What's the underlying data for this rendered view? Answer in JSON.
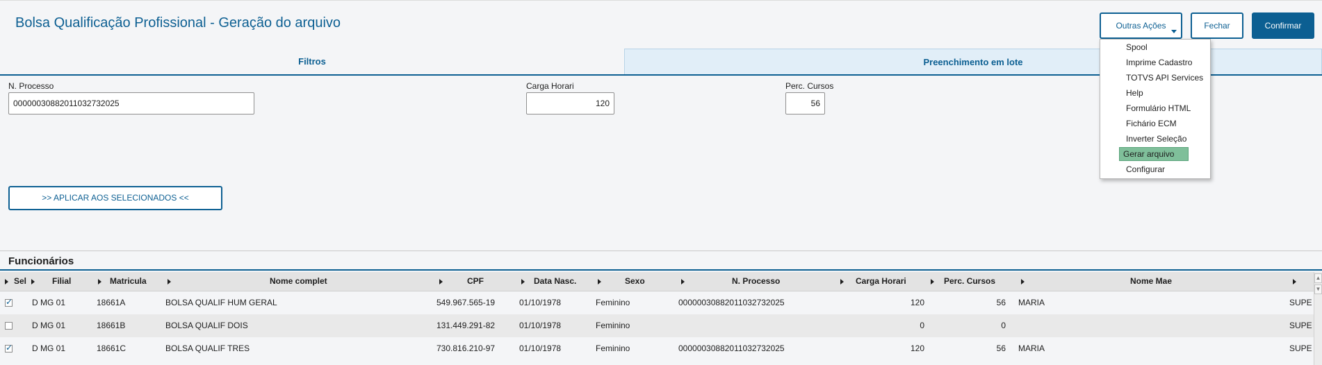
{
  "header": {
    "title": "Bolsa Qualificação Profissional - Geração do arquivo",
    "outras_acoes_label": "Outras Ações",
    "fechar_label": "Fechar",
    "confirmar_label": "Confirmar"
  },
  "tabs": [
    {
      "label": "Filtros",
      "active": false
    },
    {
      "label": "Preenchimento em lote",
      "active": true
    }
  ],
  "form": {
    "processo_label": "N. Processo",
    "processo_value": "0000003088201103273202 5",
    "carga_label": "Carga Horari",
    "carga_value": "120",
    "perc_label": "Perc. Cursos",
    "perc_value": "56",
    "apply_label": ">> APLICAR AOS SELECIONADOS <<"
  },
  "section": {
    "title": "Funcionários"
  },
  "table": {
    "headers": [
      "Sel",
      "Filial",
      "Matricula",
      "Nome complet",
      "CPF",
      "Data Nasc.",
      "Sexo",
      "N. Processo",
      "Carga Horari",
      "Perc. Cursos",
      "Nome Mae"
    ],
    "rows": [
      {
        "selected": true,
        "filial": "D MG 01",
        "matricula": "18661A",
        "nome": "BOLSA QUALIF HUM GERAL",
        "cpf": "549.967.565-19",
        "data_nasc": "01/10/1978",
        "sexo": "Feminino",
        "processo": "00000030882011032732025",
        "carga": "120",
        "perc": "56",
        "nome_mae": "MARIA",
        "extra": "SUPE"
      },
      {
        "selected": false,
        "filial": "D MG 01",
        "matricula": "18661B",
        "nome": "BOLSA QUALIF DOIS",
        "cpf": "131.449.291-82",
        "data_nasc": "01/10/1978",
        "sexo": "Feminino",
        "processo": "",
        "carga": "0",
        "perc": "0",
        "nome_mae": "",
        "extra": "SUPE"
      },
      {
        "selected": true,
        "filial": "D MG 01",
        "matricula": "18661C",
        "nome": "BOLSA QUALIF TRES",
        "cpf": "730.816.210-97",
        "data_nasc": "01/10/1978",
        "sexo": "Feminino",
        "processo": "00000030882011032732025",
        "carga": "120",
        "perc": "56",
        "nome_mae": "MARIA",
        "extra": "SUPE"
      }
    ]
  },
  "menu": {
    "items": [
      {
        "label": "Spool",
        "active": false
      },
      {
        "label": "Imprime Cadastro",
        "active": false
      },
      {
        "label": "TOTVS API Services",
        "active": false
      },
      {
        "label": "Help",
        "active": false
      },
      {
        "label": "Formulário HTML",
        "active": false
      },
      {
        "label": "Fichário ECM",
        "active": false
      },
      {
        "label": "Inverter Seleção",
        "active": false
      },
      {
        "label": "Gerar arquivo",
        "active": true
      },
      {
        "label": "Configurar",
        "active": false
      }
    ]
  },
  "colors": {
    "accent": "#0c5f92",
    "highlight": "#7fbf9a"
  }
}
